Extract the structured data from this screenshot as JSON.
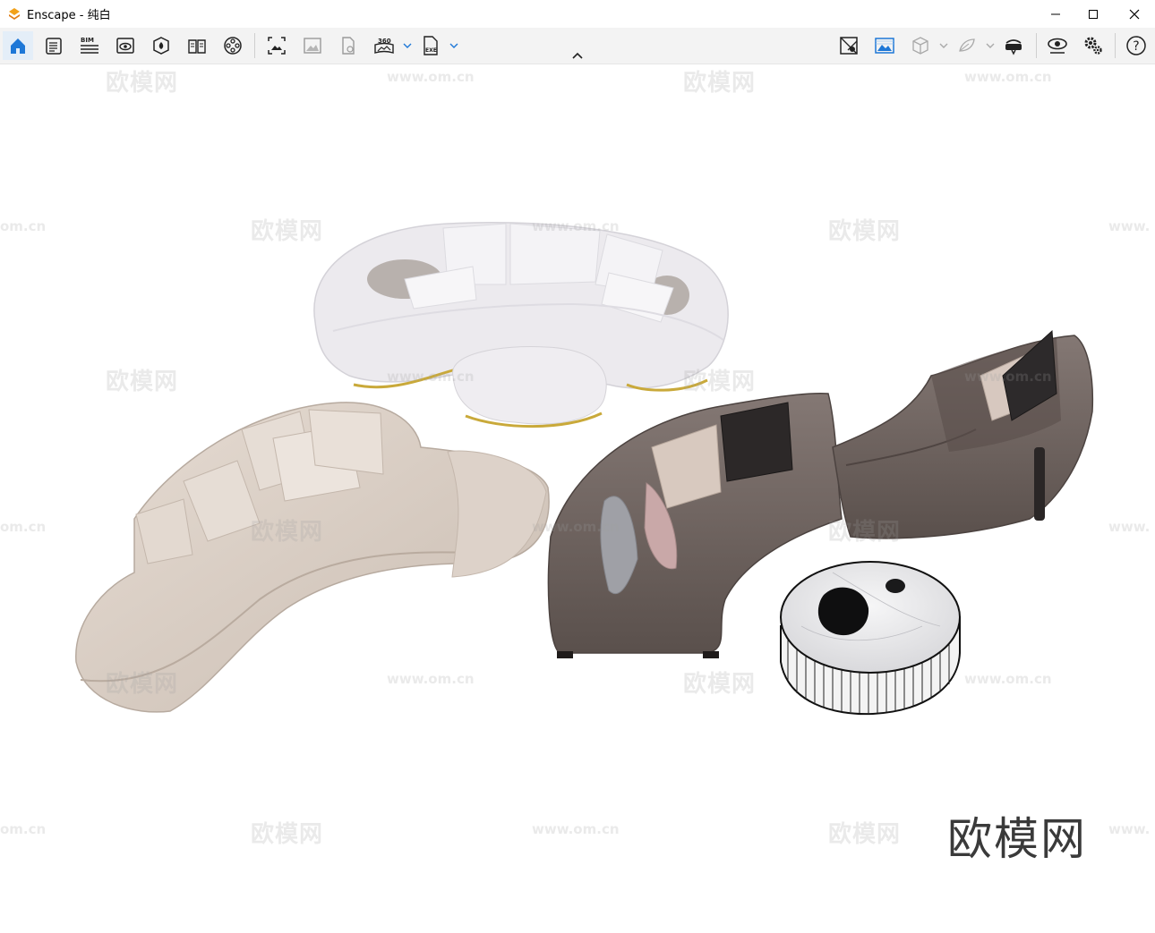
{
  "window": {
    "app_name": "Enscape",
    "separator": " - ",
    "document": "纯白",
    "controls": {
      "minimize": "minimize-icon",
      "maximize": "maximize-icon",
      "close": "close-icon"
    }
  },
  "toolbar": {
    "left_icons": [
      "home-icon",
      "notes-icon",
      "bim-icon",
      "view-eye-icon",
      "asset-library-icon",
      "book-icon",
      "video-reel-icon"
    ],
    "capture_icons": [
      "screenshot-icon",
      "batch-render-icon",
      "export-file-icon",
      "panorama-icon",
      "exe-export-icon"
    ],
    "bim_label": "BIM",
    "panorama_label": "360",
    "exe_label": "EXE",
    "right_icons": [
      "map-icon",
      "image-view-icon",
      "box-icon",
      "material-icon",
      "vr-headset-icon",
      "visual-settings-icon",
      "settings-gears-icon",
      "help-icon"
    ],
    "help_label": "?"
  },
  "watermarks": {
    "cn_text": "欧模网",
    "url_text": "www.om.cn",
    "partial_url": "om.cn",
    "partial_url_right": "www."
  },
  "brand_logo": "欧模网",
  "colors": {
    "accent": "#1e78d7",
    "toolbar_bg": "#f3f3f3",
    "viewport_bg": "#ffffff",
    "white_sofa": "#ecebee",
    "beige_sofa": "#d9cdc3",
    "brown_sofa": "#6d625d",
    "marble_table": "#e9e8ea",
    "gold_trim": "#c9a93a"
  }
}
